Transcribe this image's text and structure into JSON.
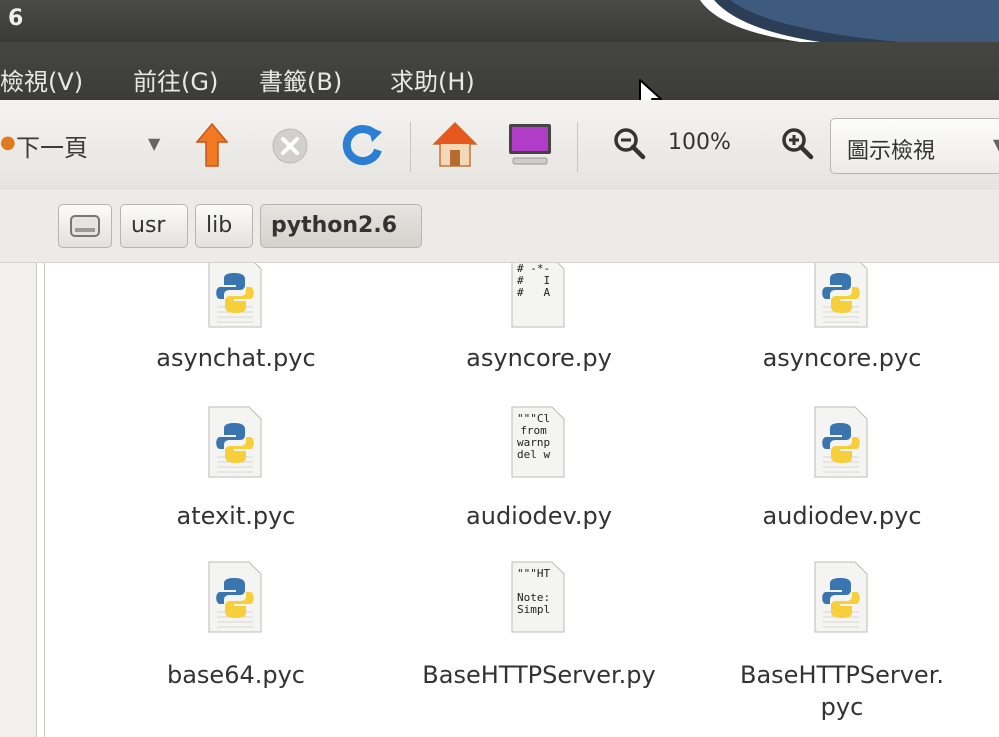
{
  "window": {
    "title": "6"
  },
  "menu": [
    {
      "label": "檢視(V)"
    },
    {
      "label": "前往(G)"
    },
    {
      "label": "書籤(B)"
    },
    {
      "label": "求助(H)"
    }
  ],
  "toolbar": {
    "forward_label": "下一頁",
    "zoom_value": "100%",
    "view_mode": "圖示檢視"
  },
  "path": {
    "root_icon": "drive-icon",
    "segments": [
      "usr",
      "lib",
      "python2.6"
    ]
  },
  "files": [
    {
      "name": "asynchat.pyc",
      "type": "pyc"
    },
    {
      "name": "asyncore.py",
      "type": "py",
      "preview": "# -*-\n#   I\n#   A"
    },
    {
      "name": "asyncore.pyc",
      "type": "pyc"
    },
    {
      "name": "atexit.pyc",
      "type": "pyc"
    },
    {
      "name": "audiodev.py",
      "type": "py",
      "preview": "\"\"\"Cl\nfrom\nwarnp\ndel w"
    },
    {
      "name": "audiodev.pyc",
      "type": "pyc"
    },
    {
      "name": "base64.pyc",
      "type": "pyc"
    },
    {
      "name": "BaseHTTPServer.py",
      "type": "py",
      "preview": "\"\"\"HT\n\nNote:\nSimpl"
    },
    {
      "name_line1": "BaseHTTPServer.",
      "name_line2": "pyc",
      "type": "pyc"
    }
  ],
  "colors": {
    "titlebar": "#3f3f3c",
    "menubar_text": "#e8e8e8",
    "accent_orange": "#e8661e",
    "toolbar_bg": "#ecebe8"
  }
}
